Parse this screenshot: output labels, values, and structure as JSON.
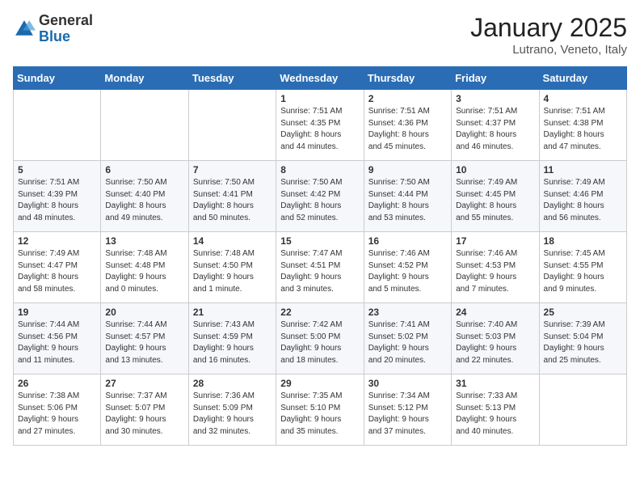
{
  "header": {
    "logo_general": "General",
    "logo_blue": "Blue",
    "month_title": "January 2025",
    "location": "Lutrano, Veneto, Italy"
  },
  "weekdays": [
    "Sunday",
    "Monday",
    "Tuesday",
    "Wednesday",
    "Thursday",
    "Friday",
    "Saturday"
  ],
  "weeks": [
    [
      {
        "day": "",
        "info": ""
      },
      {
        "day": "",
        "info": ""
      },
      {
        "day": "",
        "info": ""
      },
      {
        "day": "1",
        "info": "Sunrise: 7:51 AM\nSunset: 4:35 PM\nDaylight: 8 hours\nand 44 minutes."
      },
      {
        "day": "2",
        "info": "Sunrise: 7:51 AM\nSunset: 4:36 PM\nDaylight: 8 hours\nand 45 minutes."
      },
      {
        "day": "3",
        "info": "Sunrise: 7:51 AM\nSunset: 4:37 PM\nDaylight: 8 hours\nand 46 minutes."
      },
      {
        "day": "4",
        "info": "Sunrise: 7:51 AM\nSunset: 4:38 PM\nDaylight: 8 hours\nand 47 minutes."
      }
    ],
    [
      {
        "day": "5",
        "info": "Sunrise: 7:51 AM\nSunset: 4:39 PM\nDaylight: 8 hours\nand 48 minutes."
      },
      {
        "day": "6",
        "info": "Sunrise: 7:50 AM\nSunset: 4:40 PM\nDaylight: 8 hours\nand 49 minutes."
      },
      {
        "day": "7",
        "info": "Sunrise: 7:50 AM\nSunset: 4:41 PM\nDaylight: 8 hours\nand 50 minutes."
      },
      {
        "day": "8",
        "info": "Sunrise: 7:50 AM\nSunset: 4:42 PM\nDaylight: 8 hours\nand 52 minutes."
      },
      {
        "day": "9",
        "info": "Sunrise: 7:50 AM\nSunset: 4:44 PM\nDaylight: 8 hours\nand 53 minutes."
      },
      {
        "day": "10",
        "info": "Sunrise: 7:49 AM\nSunset: 4:45 PM\nDaylight: 8 hours\nand 55 minutes."
      },
      {
        "day": "11",
        "info": "Sunrise: 7:49 AM\nSunset: 4:46 PM\nDaylight: 8 hours\nand 56 minutes."
      }
    ],
    [
      {
        "day": "12",
        "info": "Sunrise: 7:49 AM\nSunset: 4:47 PM\nDaylight: 8 hours\nand 58 minutes."
      },
      {
        "day": "13",
        "info": "Sunrise: 7:48 AM\nSunset: 4:48 PM\nDaylight: 9 hours\nand 0 minutes."
      },
      {
        "day": "14",
        "info": "Sunrise: 7:48 AM\nSunset: 4:50 PM\nDaylight: 9 hours\nand 1 minute."
      },
      {
        "day": "15",
        "info": "Sunrise: 7:47 AM\nSunset: 4:51 PM\nDaylight: 9 hours\nand 3 minutes."
      },
      {
        "day": "16",
        "info": "Sunrise: 7:46 AM\nSunset: 4:52 PM\nDaylight: 9 hours\nand 5 minutes."
      },
      {
        "day": "17",
        "info": "Sunrise: 7:46 AM\nSunset: 4:53 PM\nDaylight: 9 hours\nand 7 minutes."
      },
      {
        "day": "18",
        "info": "Sunrise: 7:45 AM\nSunset: 4:55 PM\nDaylight: 9 hours\nand 9 minutes."
      }
    ],
    [
      {
        "day": "19",
        "info": "Sunrise: 7:44 AM\nSunset: 4:56 PM\nDaylight: 9 hours\nand 11 minutes."
      },
      {
        "day": "20",
        "info": "Sunrise: 7:44 AM\nSunset: 4:57 PM\nDaylight: 9 hours\nand 13 minutes."
      },
      {
        "day": "21",
        "info": "Sunrise: 7:43 AM\nSunset: 4:59 PM\nDaylight: 9 hours\nand 16 minutes."
      },
      {
        "day": "22",
        "info": "Sunrise: 7:42 AM\nSunset: 5:00 PM\nDaylight: 9 hours\nand 18 minutes."
      },
      {
        "day": "23",
        "info": "Sunrise: 7:41 AM\nSunset: 5:02 PM\nDaylight: 9 hours\nand 20 minutes."
      },
      {
        "day": "24",
        "info": "Sunrise: 7:40 AM\nSunset: 5:03 PM\nDaylight: 9 hours\nand 22 minutes."
      },
      {
        "day": "25",
        "info": "Sunrise: 7:39 AM\nSunset: 5:04 PM\nDaylight: 9 hours\nand 25 minutes."
      }
    ],
    [
      {
        "day": "26",
        "info": "Sunrise: 7:38 AM\nSunset: 5:06 PM\nDaylight: 9 hours\nand 27 minutes."
      },
      {
        "day": "27",
        "info": "Sunrise: 7:37 AM\nSunset: 5:07 PM\nDaylight: 9 hours\nand 30 minutes."
      },
      {
        "day": "28",
        "info": "Sunrise: 7:36 AM\nSunset: 5:09 PM\nDaylight: 9 hours\nand 32 minutes."
      },
      {
        "day": "29",
        "info": "Sunrise: 7:35 AM\nSunset: 5:10 PM\nDaylight: 9 hours\nand 35 minutes."
      },
      {
        "day": "30",
        "info": "Sunrise: 7:34 AM\nSunset: 5:12 PM\nDaylight: 9 hours\nand 37 minutes."
      },
      {
        "day": "31",
        "info": "Sunrise: 7:33 AM\nSunset: 5:13 PM\nDaylight: 9 hours\nand 40 minutes."
      },
      {
        "day": "",
        "info": ""
      }
    ]
  ]
}
